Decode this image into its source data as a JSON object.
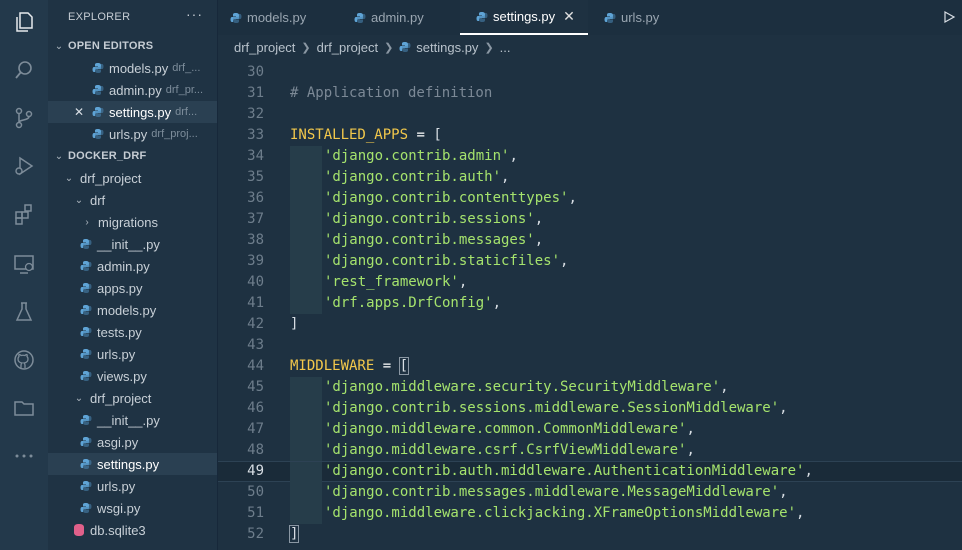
{
  "sidebar": {
    "title": "EXPLORER",
    "more": "···",
    "open_editors_label": "OPEN EDITORS",
    "open_editors": [
      {
        "name": "models.py",
        "desc": "drf_..."
      },
      {
        "name": "admin.py",
        "desc": "drf_pr..."
      },
      {
        "name": "settings.py",
        "desc": "drf...",
        "close": "✕"
      },
      {
        "name": "urls.py",
        "desc": "drf_proj..."
      }
    ],
    "project_label": "DOCKER_DRF",
    "tree": {
      "drf_project": "drf_project",
      "drf": "drf",
      "migrations": "migrations",
      "drf_files": [
        "__init__.py",
        "admin.py",
        "apps.py",
        "models.py",
        "tests.py",
        "urls.py",
        "views.py"
      ],
      "inner_project": "drf_project",
      "inner_files": [
        "__init__.py",
        "asgi.py",
        "settings.py",
        "urls.py",
        "wsgi.py"
      ],
      "db": "db.sqlite3"
    }
  },
  "tabs": [
    {
      "label": "models.py",
      "active": false
    },
    {
      "label": "admin.py",
      "active": false
    },
    {
      "label": "settings.py",
      "active": true,
      "close": "✕"
    },
    {
      "label": "urls.py",
      "active": false
    }
  ],
  "breadcrumb": {
    "items": [
      "drf_project",
      "drf_project",
      "settings.py",
      "..."
    ]
  },
  "editor": {
    "current_line": 49,
    "lines": [
      {
        "n": "30",
        "text": ""
      },
      {
        "n": "31",
        "text": "# Application definition"
      },
      {
        "n": "32",
        "text": ""
      },
      {
        "n": "33",
        "id": "INSTALLED_APPS",
        "op": " = ",
        "open": "["
      },
      {
        "n": "34",
        "str": "'django.contrib.admin'",
        "tail": ","
      },
      {
        "n": "35",
        "str": "'django.contrib.auth'",
        "tail": ","
      },
      {
        "n": "36",
        "str": "'django.contrib.contenttypes'",
        "tail": ","
      },
      {
        "n": "37",
        "str": "'django.contrib.sessions'",
        "tail": ","
      },
      {
        "n": "38",
        "str": "'django.contrib.messages'",
        "tail": ","
      },
      {
        "n": "39",
        "str": "'django.contrib.staticfiles'",
        "tail": ","
      },
      {
        "n": "40",
        "str": "'rest_framework'",
        "tail": ","
      },
      {
        "n": "41",
        "str": "'drf.apps.DrfConfig'",
        "tail": ","
      },
      {
        "n": "42",
        "close": "]"
      },
      {
        "n": "43",
        "text": ""
      },
      {
        "n": "44",
        "id": "MIDDLEWARE",
        "op": " = ",
        "open": "["
      },
      {
        "n": "45",
        "str": "'django.middleware.security.SecurityMiddleware'",
        "tail": ","
      },
      {
        "n": "46",
        "str": "'django.contrib.sessions.middleware.SessionMiddleware'",
        "tail": ","
      },
      {
        "n": "47",
        "str": "'django.middleware.common.CommonMiddleware'",
        "tail": ","
      },
      {
        "n": "48",
        "str": "'django.middleware.csrf.CsrfViewMiddleware'",
        "tail": ","
      },
      {
        "n": "49",
        "str": "'django.contrib.auth.middleware.AuthenticationMiddleware'",
        "tail": ","
      },
      {
        "n": "50",
        "str": "'django.contrib.messages.middleware.MessageMiddleware'",
        "tail": ","
      },
      {
        "n": "51",
        "str": "'django.middleware.clickjacking.XFrameOptionsMiddleware'",
        "tail": ","
      },
      {
        "n": "52",
        "close": "]"
      }
    ]
  },
  "colors": {
    "python_icon": "#5fa4d6",
    "keyword_yellow": "#f2c84b",
    "string_green": "#a5e36d",
    "comment_gray": "#7c8996"
  }
}
